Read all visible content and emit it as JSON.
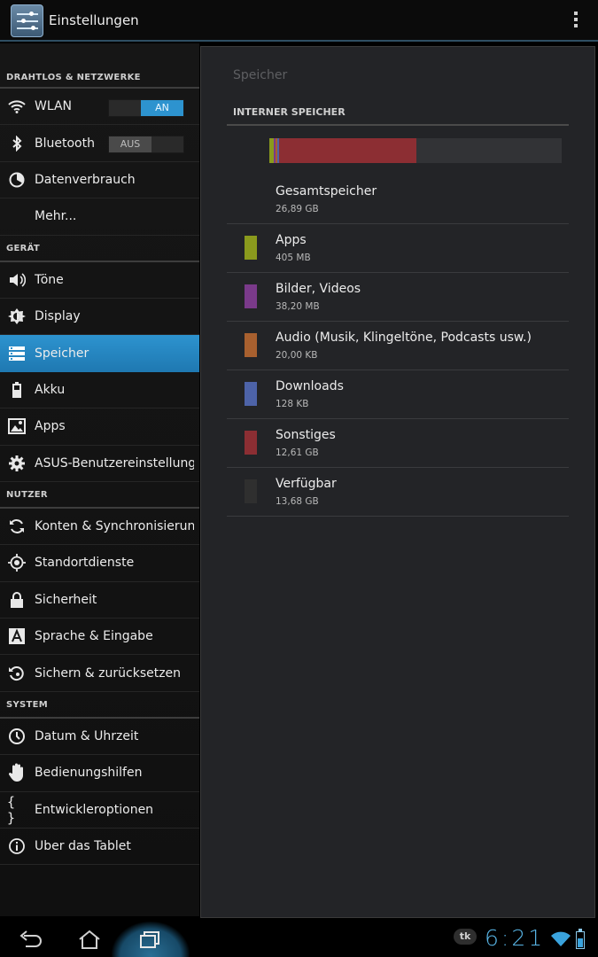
{
  "app": {
    "title": "Einstellungen"
  },
  "sidebar": {
    "sections": [
      {
        "label": "DRAHTLOS & NETZWERKE"
      },
      {
        "label": "GERÄT"
      },
      {
        "label": "NUTZER"
      },
      {
        "label": "SYSTEM"
      }
    ],
    "items": [
      {
        "label": "WLAN",
        "icon": "wifi-icon",
        "toggle": "AN"
      },
      {
        "label": "Bluetooth",
        "icon": "bluetooth-icon",
        "toggle": "AUS"
      },
      {
        "label": "Datenverbrauch",
        "icon": "data-usage-icon"
      },
      {
        "label": "Mehr..."
      },
      {
        "label": "Töne",
        "icon": "volume-icon"
      },
      {
        "label": "Display",
        "icon": "brightness-icon"
      },
      {
        "label": "Speicher",
        "icon": "storage-icon"
      },
      {
        "label": "Akku",
        "icon": "battery-icon"
      },
      {
        "label": "Apps",
        "icon": "apps-icon"
      },
      {
        "label": "ASUS-Benutzereinstellungen",
        "icon": "gear-icon"
      },
      {
        "label": "Konten & Synchronisierung",
        "icon": "sync-icon"
      },
      {
        "label": "Standortdienste",
        "icon": "location-icon"
      },
      {
        "label": "Sicherheit",
        "icon": "lock-icon"
      },
      {
        "label": "Sprache & Eingabe",
        "icon": "language-icon"
      },
      {
        "label": "Sichern & zurücksetzen",
        "icon": "backup-icon"
      },
      {
        "label": "Datum & Uhrzeit",
        "icon": "clock-icon"
      },
      {
        "label": "Bedienungshilfen",
        "icon": "accessibility-hand-icon"
      },
      {
        "label": "Entwickleroptionen",
        "icon": "developer-braces-icon"
      },
      {
        "label": "Über das Tablet",
        "icon": "info-icon"
      }
    ]
  },
  "main": {
    "title": "Speicher",
    "subheader": "INTERNER SPEICHER",
    "usage": [
      {
        "name": "Apps",
        "fraction": 0.015,
        "color": "#8a9a1d"
      },
      {
        "name": "Bilder, Videos",
        "fraction": 0.006,
        "color": "#7a3a8a"
      },
      {
        "name": "Audio",
        "fraction": 0.003,
        "color": "#a8602f"
      },
      {
        "name": "Downloads",
        "fraction": 0.006,
        "color": "#4d63a8"
      },
      {
        "name": "Sonstiges",
        "fraction": 0.469,
        "color": "#8c2e33"
      },
      {
        "name": "Verfügbar",
        "fraction": 0.501,
        "color": "#323336"
      }
    ],
    "rows": [
      {
        "name": "Gesamtspeicher",
        "value": "26,89 GB",
        "color": ""
      },
      {
        "name": "Apps",
        "value": "405 MB",
        "color": "#8a9a1d"
      },
      {
        "name": "Bilder, Videos",
        "value": "38,20 MB",
        "color": "#7a3a8a"
      },
      {
        "name": "Audio (Musik, Klingeltöne, Podcasts usw.)",
        "value": "20,00 KB",
        "color": "#a8602f"
      },
      {
        "name": "Downloads",
        "value": "128 KB",
        "color": "#4d63a8"
      },
      {
        "name": "Sonstiges",
        "value": "12,61 GB",
        "color": "#8c2e33"
      },
      {
        "name": "Verfügbar",
        "value": "13,68 GB",
        "color": "#2f2f2f"
      }
    ]
  },
  "statusbar": {
    "badge": "tk",
    "time": "6:21",
    "battery_level": 0.6
  },
  "navbar": {
    "buttons": [
      "back-icon",
      "home-icon",
      "recent-apps-icon"
    ]
  }
}
